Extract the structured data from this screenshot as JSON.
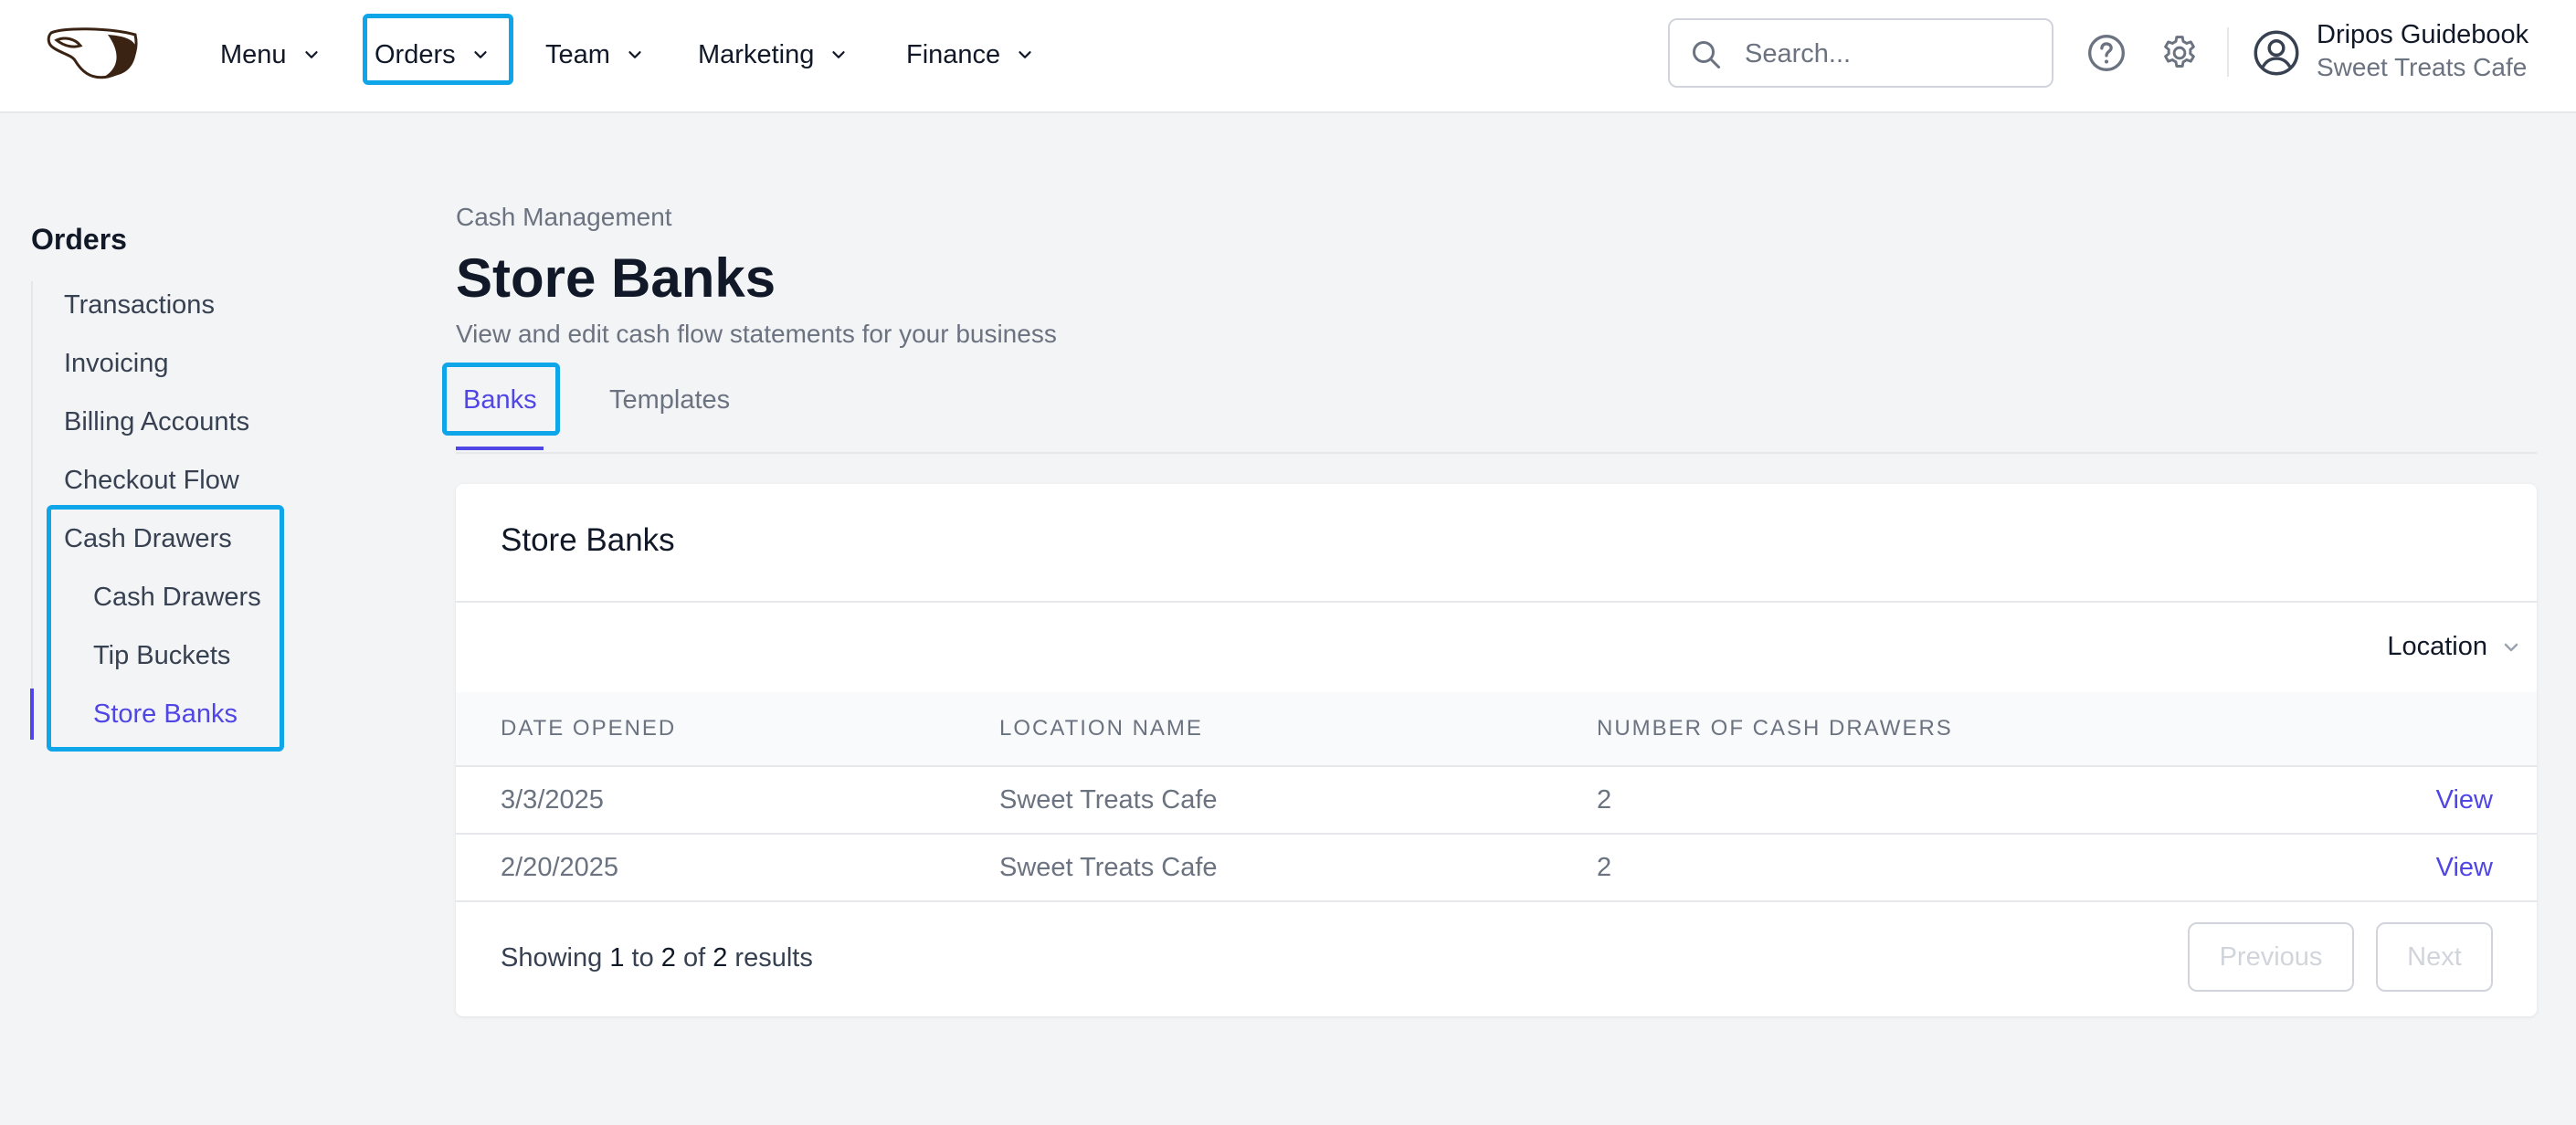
{
  "nav": {
    "items": [
      {
        "label": "Menu"
      },
      {
        "label": "Orders"
      },
      {
        "label": "Team"
      },
      {
        "label": "Marketing"
      },
      {
        "label": "Finance"
      }
    ],
    "search_placeholder": "Search...",
    "user_name": "Dripos Guidebook",
    "user_org": "Sweet Treats Cafe"
  },
  "sidebar": {
    "title": "Orders",
    "items": [
      {
        "label": "Transactions"
      },
      {
        "label": "Invoicing"
      },
      {
        "label": "Billing Accounts"
      },
      {
        "label": "Checkout Flow"
      },
      {
        "label": "Cash Drawers"
      }
    ],
    "subitems": [
      {
        "label": "Cash Drawers"
      },
      {
        "label": "Tip Buckets"
      },
      {
        "label": "Store Banks"
      }
    ],
    "active": "Store Banks"
  },
  "page": {
    "breadcrumb": "Cash Management",
    "title": "Store Banks",
    "subtitle": "View and edit cash flow statements for your business",
    "tabs": [
      {
        "label": "Banks"
      },
      {
        "label": "Templates"
      }
    ],
    "active_tab": "Banks"
  },
  "card": {
    "title": "Store Banks",
    "filter_label": "Location",
    "columns": [
      "Date Opened",
      "Location Name",
      "Number of Cash Drawers"
    ],
    "rows": [
      {
        "date": "3/3/2025",
        "location": "Sweet Treats Cafe",
        "drawers": "2",
        "action": "View"
      },
      {
        "date": "2/20/2025",
        "location": "Sweet Treats Cafe",
        "drawers": "2",
        "action": "View"
      }
    ],
    "footer": {
      "prefix": "Showing",
      "from": "1",
      "to_word": "to",
      "to": "2",
      "of_word": "of",
      "total": "2",
      "suffix": "results"
    },
    "prev_label": "Previous",
    "next_label": "Next"
  },
  "colors": {
    "accent": "#4f46e5",
    "highlight": "#0ea5e9"
  }
}
